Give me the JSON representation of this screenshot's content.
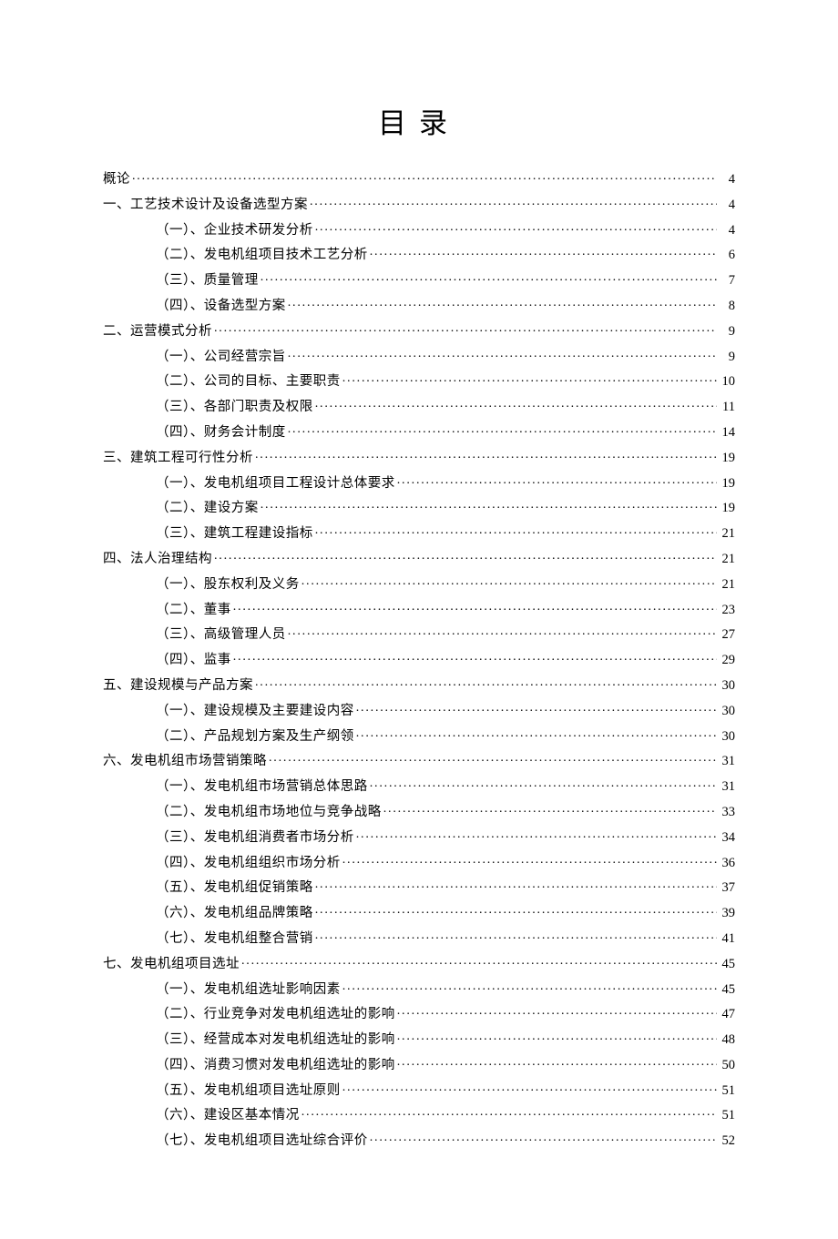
{
  "title": "目录",
  "toc": [
    {
      "level": 0,
      "label": "概论",
      "page": "4"
    },
    {
      "level": 0,
      "label": "一、工艺技术设计及设备选型方案",
      "page": "4"
    },
    {
      "level": 1,
      "label": "（一）、企业技术研发分析",
      "page": "4"
    },
    {
      "level": 1,
      "label": "（二）、发电机组项目技术工艺分析",
      "page": "6"
    },
    {
      "level": 1,
      "label": "（三）、质量管理",
      "page": "7"
    },
    {
      "level": 1,
      "label": "（四）、设备选型方案",
      "page": "8"
    },
    {
      "level": 0,
      "label": "二、运营模式分析",
      "page": "9"
    },
    {
      "level": 1,
      "label": "（一）、公司经营宗旨",
      "page": "9"
    },
    {
      "level": 1,
      "label": "（二）、公司的目标、主要职责",
      "page": "10"
    },
    {
      "level": 1,
      "label": "（三）、各部门职责及权限",
      "page": "11"
    },
    {
      "level": 1,
      "label": "（四）、财务会计制度",
      "page": "14"
    },
    {
      "level": 0,
      "label": "三、建筑工程可行性分析",
      "page": "19"
    },
    {
      "level": 1,
      "label": "（一）、发电机组项目工程设计总体要求",
      "page": "19"
    },
    {
      "level": 1,
      "label": "（二）、建设方案",
      "page": "19"
    },
    {
      "level": 1,
      "label": "（三）、建筑工程建设指标",
      "page": "21"
    },
    {
      "level": 0,
      "label": "四、法人治理结构",
      "page": "21"
    },
    {
      "level": 1,
      "label": "（一）、股东权利及义务",
      "page": "21"
    },
    {
      "level": 1,
      "label": "（二）、董事",
      "page": "23"
    },
    {
      "level": 1,
      "label": "（三）、高级管理人员",
      "page": "27"
    },
    {
      "level": 1,
      "label": "（四）、监事",
      "page": "29"
    },
    {
      "level": 0,
      "label": "五、建设规模与产品方案",
      "page": "30"
    },
    {
      "level": 1,
      "label": "（一）、建设规模及主要建设内容",
      "page": "30"
    },
    {
      "level": 1,
      "label": "（二）、产品规划方案及生产纲领",
      "page": "30"
    },
    {
      "level": 0,
      "label": "六、发电机组市场营销策略",
      "page": "31"
    },
    {
      "level": 1,
      "label": "（一）、发电机组市场营销总体思路",
      "page": "31"
    },
    {
      "level": 1,
      "label": "（二）、发电机组市场地位与竞争战略",
      "page": "33"
    },
    {
      "level": 1,
      "label": "（三）、发电机组消费者市场分析",
      "page": "34"
    },
    {
      "level": 1,
      "label": "（四）、发电机组组织市场分析",
      "page": "36"
    },
    {
      "level": 1,
      "label": "（五）、发电机组促销策略",
      "page": "37"
    },
    {
      "level": 1,
      "label": "（六）、发电机组品牌策略",
      "page": "39"
    },
    {
      "level": 1,
      "label": "（七）、发电机组整合营销",
      "page": "41"
    },
    {
      "level": 0,
      "label": "七、发电机组项目选址",
      "page": "45"
    },
    {
      "level": 1,
      "label": "（一）、发电机组选址影响因素",
      "page": "45"
    },
    {
      "level": 1,
      "label": "（二）、行业竞争对发电机组选址的影响",
      "page": "47"
    },
    {
      "level": 1,
      "label": "（三）、经营成本对发电机组选址的影响",
      "page": "48"
    },
    {
      "level": 1,
      "label": "（四）、消费习惯对发电机组选址的影响",
      "page": "50"
    },
    {
      "level": 1,
      "label": "（五）、发电机组项目选址原则",
      "page": "51"
    },
    {
      "level": 1,
      "label": "（六）、建设区基本情况",
      "page": "51"
    },
    {
      "level": 1,
      "label": "（七）、发电机组项目选址综合评价",
      "page": "52"
    }
  ]
}
